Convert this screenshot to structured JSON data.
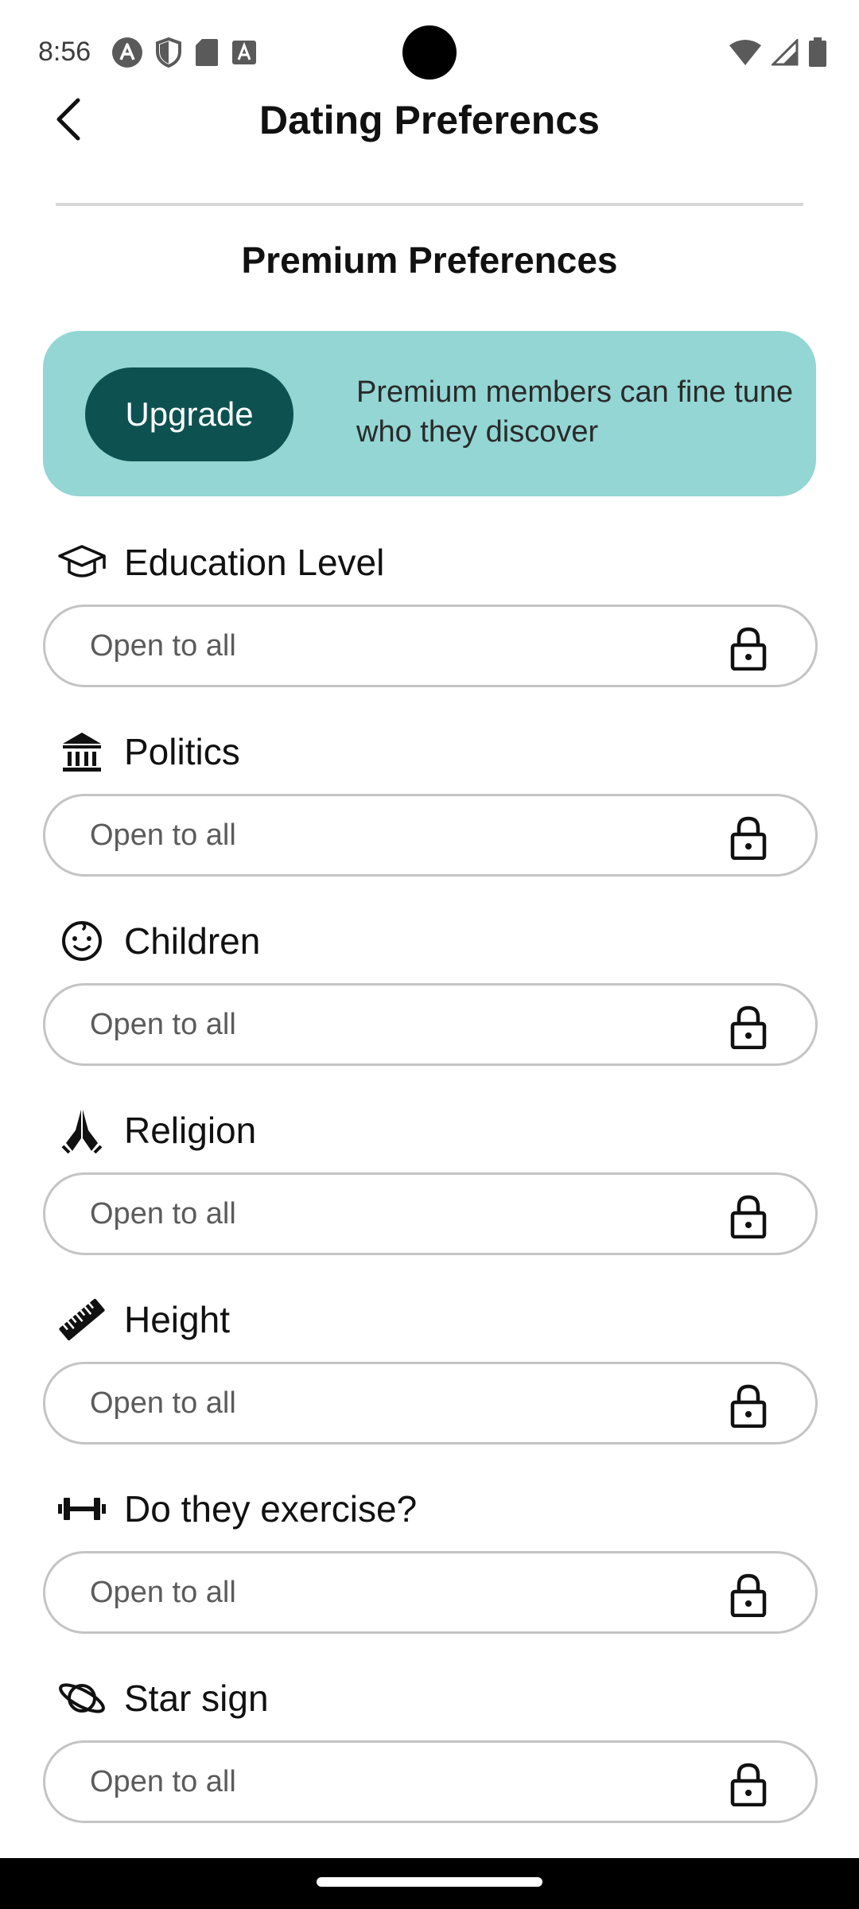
{
  "status_bar": {
    "time": "8:56",
    "icons_left": [
      "autofill-icon",
      "shield-icon",
      "sd-card-icon",
      "keyboard-a-icon"
    ],
    "icons_right": [
      "wifi-icon",
      "signal-icon",
      "battery-icon"
    ]
  },
  "header": {
    "title": "Dating Preferencs",
    "back_icon": "chevron-left-icon"
  },
  "section_title": "Premium Preferences",
  "upgrade": {
    "button_label": "Upgrade",
    "message": "Premium members can fine tune who they discover",
    "card_color": "#93d6d4",
    "button_color": "#0d5250"
  },
  "preferences": [
    {
      "label": "Education Level",
      "value": "Open to all",
      "icon": "graduation-cap-icon"
    },
    {
      "label": "Politics",
      "value": "Open to all",
      "icon": "bank-building-icon"
    },
    {
      "label": "Children",
      "value": "Open to all",
      "icon": "baby-face-icon"
    },
    {
      "label": "Religion",
      "value": "Open to all",
      "icon": "praying-hands-icon"
    },
    {
      "label": "Height",
      "value": "Open to all",
      "icon": "ruler-icon"
    },
    {
      "label": "Do they exercise?",
      "value": "Open to all",
      "icon": "dumbbell-icon"
    },
    {
      "label": "Star sign",
      "value": "Open to all",
      "icon": "planet-icon"
    }
  ],
  "lock_icon": "lock-icon"
}
